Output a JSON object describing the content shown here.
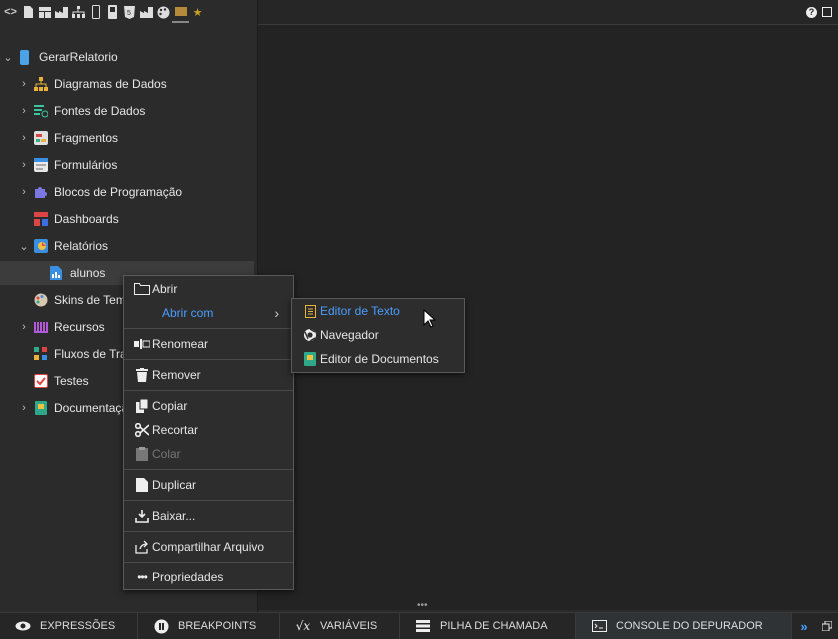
{
  "toolbar": {
    "icons": [
      "code-icon",
      "file-icon",
      "layout-icon",
      "factory-icon",
      "sitemap-icon",
      "mobile-icon",
      "device-icon",
      "html5-icon",
      "factory-alt-icon",
      "palette-icon",
      "folder-icon",
      "star-icon"
    ]
  },
  "tree": {
    "project": "GerarRelatorio",
    "items": [
      {
        "label": "Diagramas de Dados"
      },
      {
        "label": "Fontes de Dados"
      },
      {
        "label": "Fragmentos"
      },
      {
        "label": "Formulários"
      },
      {
        "label": "Blocos de Programação"
      },
      {
        "label": "Dashboards"
      },
      {
        "label": "Relatórios"
      },
      {
        "label": "alunos"
      },
      {
        "label": "Skins de Tem"
      },
      {
        "label": "Recursos"
      },
      {
        "label": "Fluxos de Tra"
      },
      {
        "label": "Testes"
      },
      {
        "label": "Documentaçã"
      }
    ]
  },
  "context_menu": {
    "open": "Abrir",
    "open_with": "Abrir com",
    "rename": "Renomear",
    "remove": "Remover",
    "copy": "Copiar",
    "cut": "Recortar",
    "paste": "Colar",
    "duplicate": "Duplicar",
    "download": "Baixar...",
    "share": "Compartilhar Arquivo",
    "properties": "Propriedades"
  },
  "submenu": {
    "text_editor": "Editor de Texto",
    "browser": "Navegador",
    "doc_editor": "Editor de Documentos"
  },
  "bottom_tabs": {
    "expressions": "EXPRESSÕES",
    "breakpoints": "BREAKPOINTS",
    "variables": "VARIÁVEIS",
    "call_stack": "PILHA DE CHAMADA",
    "debug_console": "CONSOLE DO DEPURADOR"
  },
  "colors": {
    "accent": "#4a9eff",
    "menu_bg": "#2d2d2d",
    "panel_bg": "#2b2b2b"
  }
}
